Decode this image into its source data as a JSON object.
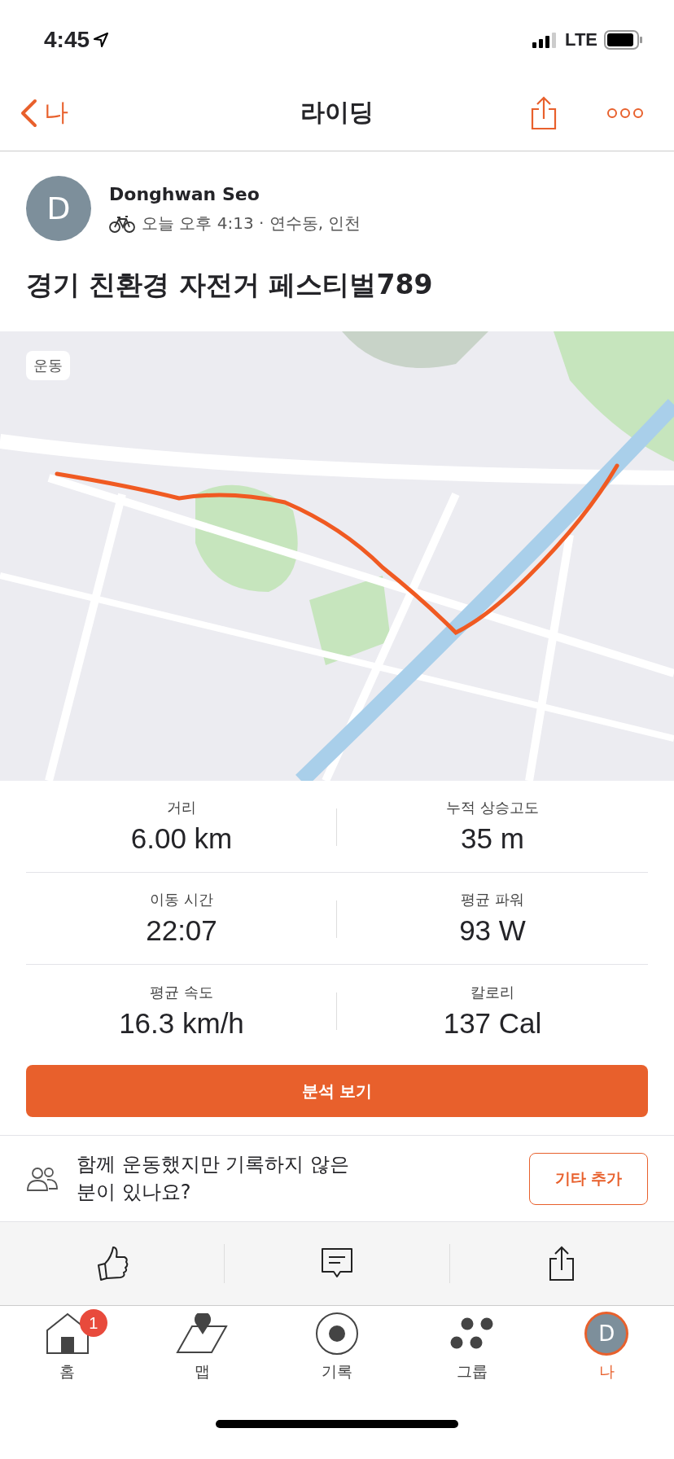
{
  "status_bar": {
    "time": "4:45",
    "network": "LTE"
  },
  "header": {
    "back_label": "나",
    "title": "라이딩"
  },
  "activity": {
    "avatar_letter": "D",
    "athlete": "Donghwan Seo",
    "meta": "오늘 오후 4:13 · 연수동, 인천",
    "title": "경기 친환경 자전거 페스티벌789"
  },
  "map": {
    "kind": "picture",
    "badge": "운동"
  },
  "stats": [
    {
      "label": "거리",
      "value": "6.00 km"
    },
    {
      "label": "누적 상승고도",
      "value": "35 m"
    },
    {
      "label": "이동 시간",
      "value": "22:07"
    },
    {
      "label": "평균 파워",
      "value": "93 W"
    },
    {
      "label": "평균 속도",
      "value": "16.3 km/h"
    },
    {
      "label": "칼로리",
      "value": "137 Cal"
    }
  ],
  "analysis_button": "분석 보기",
  "group_prompt": {
    "text": "함께 운동했지만 기록하지 않은\n분이 있나요?",
    "button": "기타 추가"
  },
  "tab_bar": [
    {
      "kind": "home",
      "label": "홈",
      "badge": "1",
      "selected": false
    },
    {
      "kind": "map",
      "label": "맵",
      "selected": false
    },
    {
      "kind": "record",
      "label": "기록",
      "selected": false
    },
    {
      "kind": "groups",
      "label": "그룹",
      "selected": false
    },
    {
      "kind": "profile",
      "label": "나",
      "avatar_letter": "D",
      "selected": true
    }
  ]
}
